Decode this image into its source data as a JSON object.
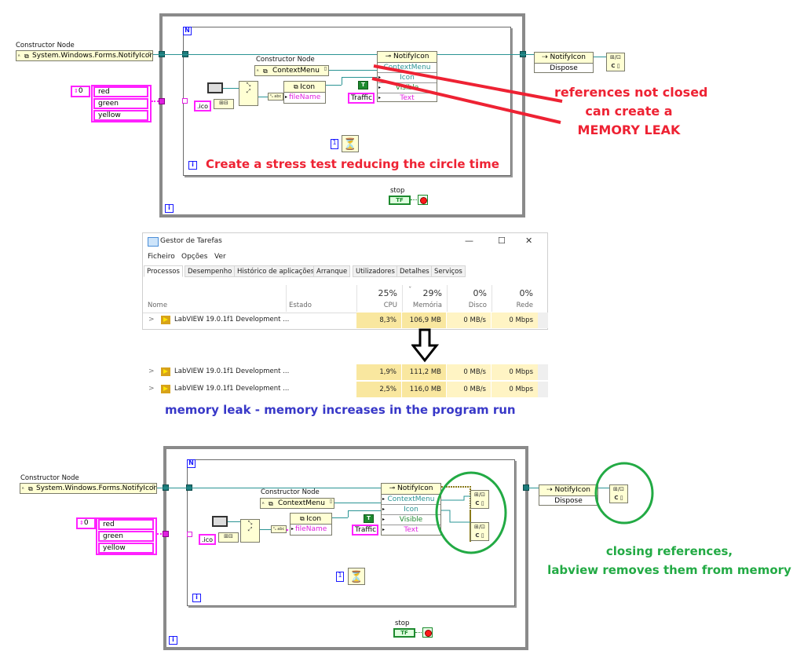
{
  "top_diagram": {
    "constructor_label": "Constructor Node",
    "constructor_class": "System.Windows.Forms.NotifyIcon",
    "array_index": "0",
    "array_items": [
      "red",
      "green",
      "yellow"
    ],
    "for_loop_terminal": "N",
    "inner_constructor_label": "Constructor Node",
    "inner_constructor_class": "ContextMenu",
    "ico_constant": ".ico",
    "icon_constructor": "Icon",
    "icon_param": "fileName",
    "property_node": {
      "class": "NotifyIcon",
      "rows": [
        "ContextMenu",
        "Icon",
        "Visible",
        "Text"
      ]
    },
    "true_constant": "T",
    "text_constant": "Traffic",
    "wait_constant": "1",
    "iteration_terminal": "i",
    "stop_label": "stop",
    "stop_control": "TF",
    "invoke_node": {
      "class": "NotifyIcon",
      "method": "Dispose"
    },
    "close_ref_glyph": "C",
    "annotation_loop": "Create a stress test reducing the circle time",
    "annotation_leak": [
      "references not closed",
      "can create a",
      "MEMORY LEAK"
    ]
  },
  "task_manager": {
    "title": "Gestor de Tarefas",
    "window_buttons": {
      "minimize": "—",
      "maximize": "☐",
      "close": "✕"
    },
    "menu": [
      "Ficheiro",
      "Opções",
      "Ver"
    ],
    "tabs": [
      "Processos",
      "Desempenho",
      "Histórico de aplicações",
      "Arranque",
      "Utilizadores",
      "Detalhes",
      "Serviços"
    ],
    "active_tab": "Processos",
    "columns": {
      "name": "Nome",
      "status": "Estado",
      "cpu": {
        "label": "CPU",
        "total": "25%"
      },
      "memory": {
        "label": "Memória",
        "total": "29%",
        "sort_indicator": "ˇ"
      },
      "disk": {
        "label": "Disco",
        "total": "0%"
      },
      "network": {
        "label": "Rede",
        "total": "0%"
      }
    },
    "processes": [
      {
        "name": "LabVIEW 19.0.1f1 Development ...",
        "cpu": "8,3%",
        "memory": "106,9 MB",
        "disk": "0 MB/s",
        "network": "0 Mbps"
      },
      {
        "name": "LabVIEW 19.0.1f1 Development ...",
        "cpu": "1,9%",
        "memory": "111,2 MB",
        "disk": "0 MB/s",
        "network": "0 Mbps"
      },
      {
        "name": "LabVIEW 19.0.1f1 Development ...",
        "cpu": "2,5%",
        "memory": "116,0 MB",
        "disk": "0 MB/s",
        "network": "0 Mbps"
      }
    ]
  },
  "memory_annotation": "memory leak - memory increases in the program run",
  "bottom_diagram": {
    "constructor_label": "Constructor Node",
    "constructor_class": "System.Windows.Forms.NotifyIcon",
    "array_index": "0",
    "array_items": [
      "red",
      "green",
      "yellow"
    ],
    "for_loop_terminal": "N",
    "inner_constructor_label": "Constructor Node",
    "inner_constructor_class": "ContextMenu",
    "ico_constant": ".ico",
    "icon_constructor": "Icon",
    "icon_param": "fileName",
    "property_node": {
      "class": "NotifyIcon",
      "rows": [
        "ContextMenu",
        "Icon",
        "Visible",
        "Text"
      ]
    },
    "true_constant": "T",
    "text_constant": "Traffic",
    "wait_constant": "1",
    "iteration_terminal": "i",
    "stop_label": "stop",
    "stop_control": "TF",
    "invoke_node": {
      "class": "NotifyIcon",
      "method": "Dispose"
    },
    "close_ref_glyph": "C",
    "annotation_fix": [
      "closing references,",
      "labview removes them from memory"
    ]
  },
  "colors": {
    "annotation_red": "#ee2233",
    "annotation_blue": "#3838c8",
    "annotation_green": "#22aa44",
    "wire_teal": "#2a9494",
    "wire_pink": "#ff22ff",
    "node_fill": "#ffffd4",
    "memory_cell": "#f9e79f"
  }
}
